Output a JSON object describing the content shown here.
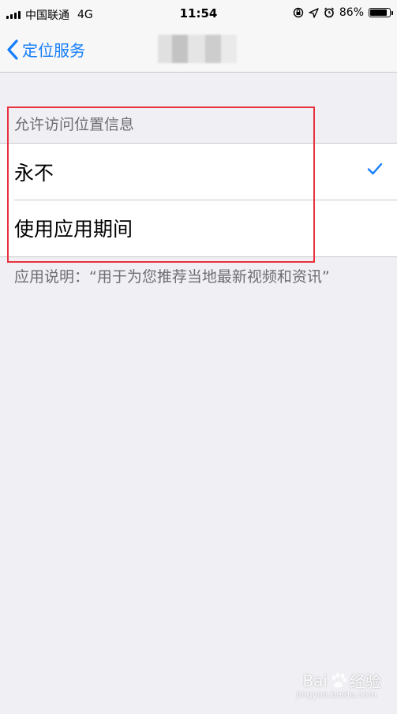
{
  "status_bar": {
    "carrier": "中国联通",
    "network": "4G",
    "time": "11:54",
    "battery": "86%",
    "battery_level": 0.86
  },
  "nav": {
    "back_label": "定位服务"
  },
  "section": {
    "header": "允许访问位置信息",
    "options": [
      {
        "label": "永不",
        "selected": true
      },
      {
        "label": "使用应用期间",
        "selected": false
      }
    ],
    "footer": "应用说明：“用于为您推荐当地最新视频和资讯”"
  },
  "watermark": {
    "text_left": "Bai",
    "text_right": "经验",
    "domain": "jingyan.baidu.com"
  },
  "colors": {
    "accent": "#157efb",
    "highlight": "#e8313c",
    "background": "#efeff4"
  }
}
